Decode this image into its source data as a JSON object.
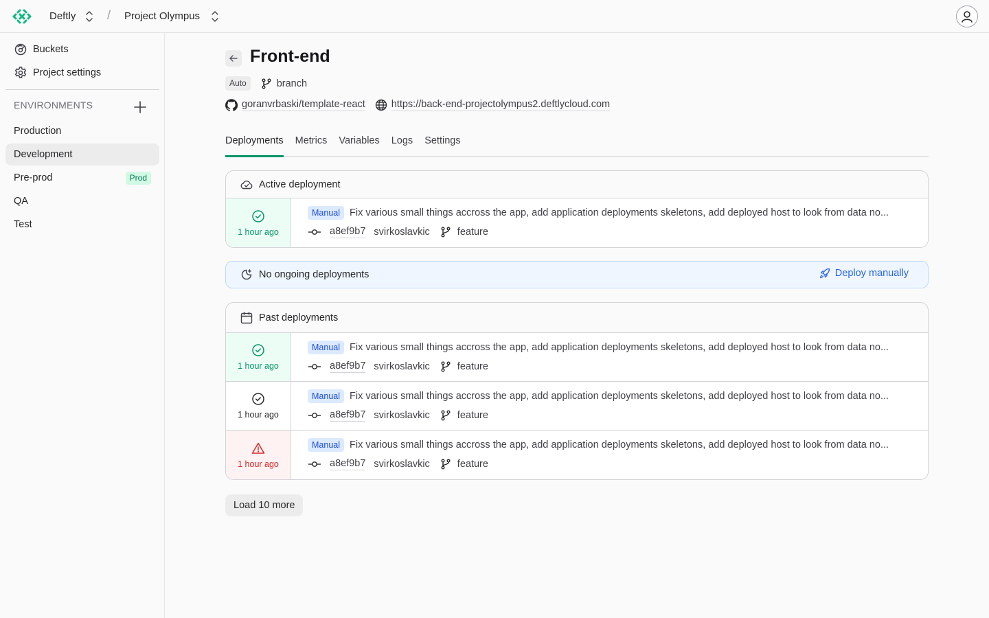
{
  "topbar": {
    "org": "Deftly",
    "project": "Project Olympus",
    "separator": "/"
  },
  "sidebar": {
    "links": [
      {
        "label": "Buckets",
        "icon": "bucket-icon"
      },
      {
        "label": "Project settings",
        "icon": "gear-icon"
      }
    ],
    "environments_heading": "ENVIRONMENTS",
    "environments": [
      {
        "label": "Production",
        "active": false,
        "badge": null
      },
      {
        "label": "Development",
        "active": true,
        "badge": null
      },
      {
        "label": "Pre-prod",
        "active": false,
        "badge": "Prod"
      },
      {
        "label": "QA",
        "active": false,
        "badge": null
      },
      {
        "label": "Test",
        "active": false,
        "badge": null
      }
    ]
  },
  "service": {
    "title": "Front-end",
    "trigger_badge": "Auto",
    "trigger_type": "branch",
    "repo": "goranvrbaski/template-react",
    "url": "https://back-end-projectolympus2.deftlycloud.com"
  },
  "tabs": [
    {
      "label": "Deployments",
      "active": true
    },
    {
      "label": "Metrics",
      "active": false
    },
    {
      "label": "Variables",
      "active": false
    },
    {
      "label": "Logs",
      "active": false
    },
    {
      "label": "Settings",
      "active": false
    }
  ],
  "active_deployment": {
    "heading": "Active deployment",
    "item": {
      "status": "success",
      "time": "1 hour ago",
      "badge": "Manual",
      "message": "Fix various small things accross the app, add application deployments skeletons, add deployed host to look from data no...",
      "sha": "a8ef9b7",
      "author": "svirkoslavkic",
      "branch": "feature"
    }
  },
  "ongoing": {
    "text": "No ongoing deployments",
    "action": "Deploy manually"
  },
  "past_deployments": {
    "heading": "Past deployments",
    "items": [
      {
        "status": "success",
        "time": "1 hour ago",
        "badge": "Manual",
        "message": "Fix various small things accross the app, add application deployments skeletons, add deployed host to look from data no...",
        "sha": "a8ef9b7",
        "author": "svirkoslavkic",
        "branch": "feature"
      },
      {
        "status": "inactive",
        "time": "1 hour ago",
        "badge": "Manual",
        "message": "Fix various small things accross the app, add application deployments skeletons, add deployed host to look from data no...",
        "sha": "a8ef9b7",
        "author": "svirkoslavkic",
        "branch": "feature"
      },
      {
        "status": "failed",
        "time": "1 hour ago",
        "badge": "Manual",
        "message": "Fix various small things accross the app, add application deployments skeletons, add deployed host to look from data no...",
        "sha": "a8ef9b7",
        "author": "svirkoslavkic",
        "branch": "feature"
      }
    ]
  },
  "load_more": "Load 10 more",
  "colors": {
    "accent": "#059669",
    "success_bg": "#ecfdf5",
    "error": "#dc2626",
    "error_bg": "#fef2f2",
    "info": "#2563eb",
    "info_bg": "#eff6ff"
  }
}
